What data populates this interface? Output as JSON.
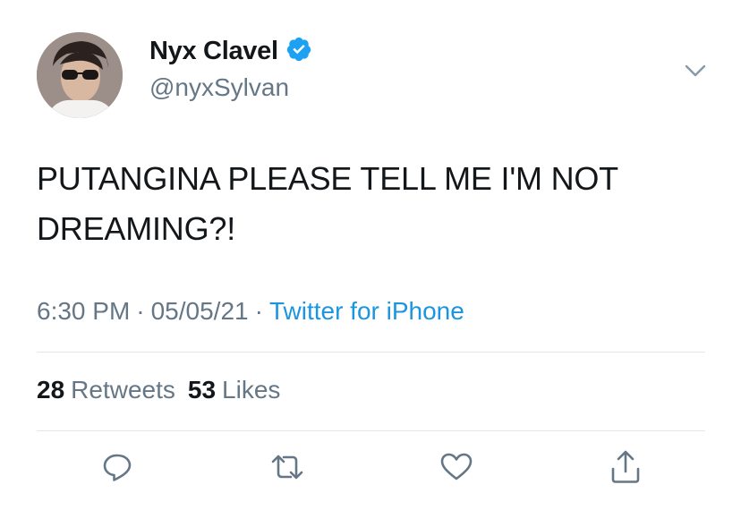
{
  "user": {
    "display_name": "Nyx Clavel",
    "handle": "@nyxSylvan",
    "verified": true
  },
  "tweet": {
    "text": "PUTANGINA PLEASE TELL ME I'M NOT DREAMING?!",
    "time": "6:30 PM",
    "date": "05/05/21",
    "separator": "·",
    "source": "Twitter for iPhone"
  },
  "stats": {
    "retweets_count": "28",
    "retweets_label": "Retweets",
    "likes_count": "53",
    "likes_label": "Likes"
  },
  "icons": {
    "verified": "verified-badge-icon",
    "more": "chevron-down-icon",
    "reply": "reply-icon",
    "retweet": "retweet-icon",
    "like": "heart-icon",
    "share": "share-icon"
  },
  "colors": {
    "text": "#14171a",
    "secondary": "#657786",
    "link": "#1b95e0",
    "verified": "#1da1f2",
    "divider": "#e1e8ed"
  }
}
